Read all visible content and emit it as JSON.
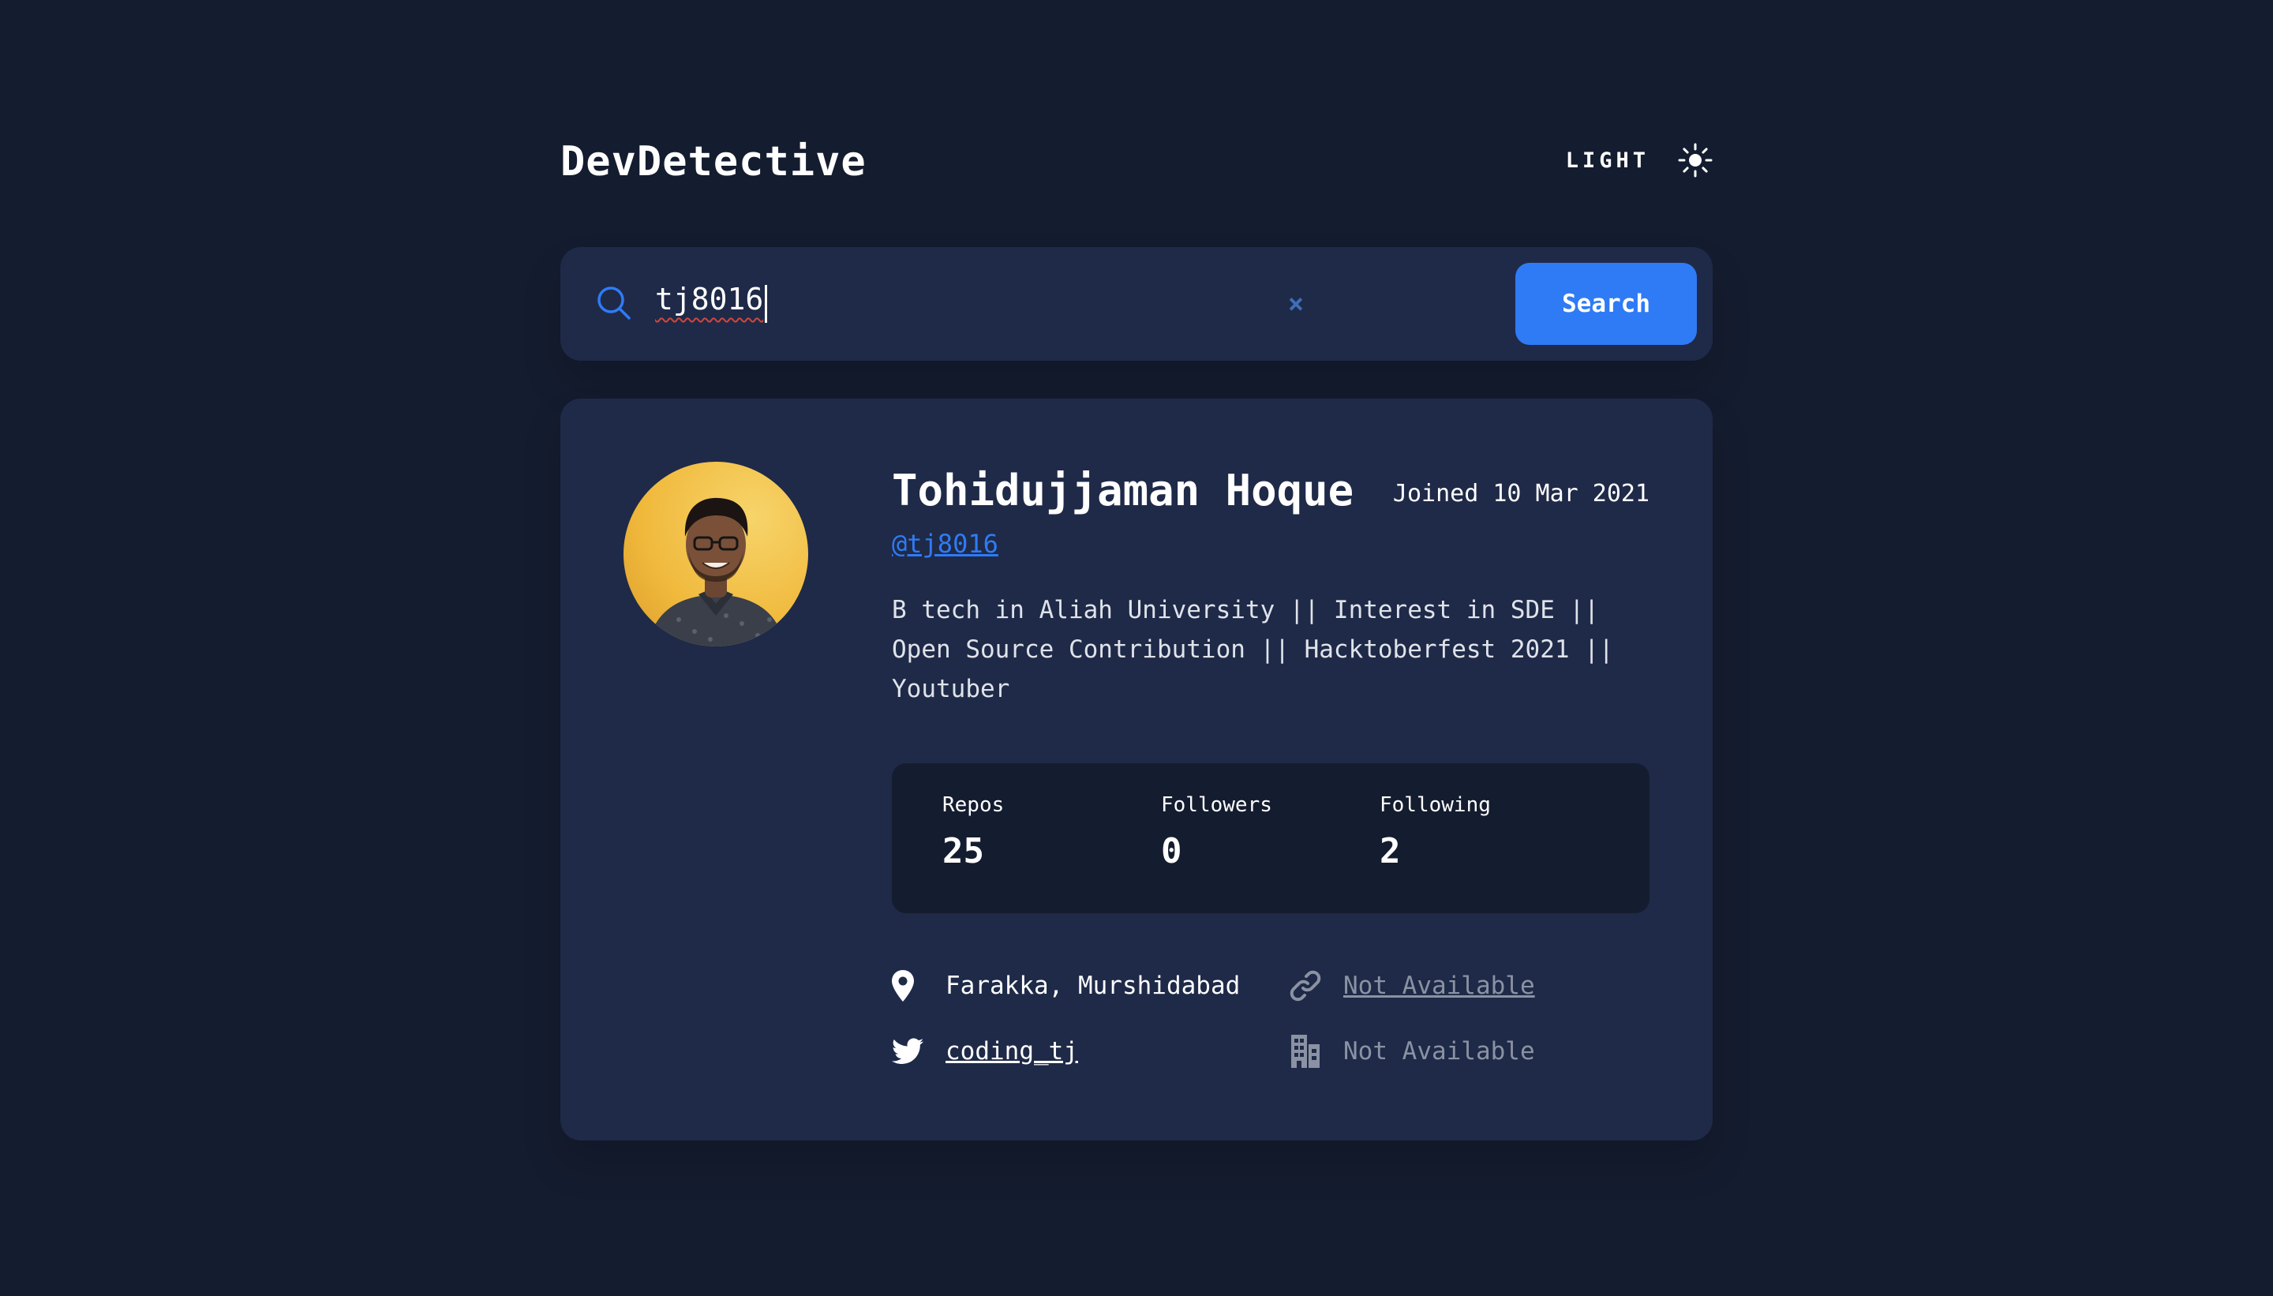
{
  "app": {
    "title": "DevDetective",
    "theme_toggle_label": "LIGHT",
    "theme_icon": "sun-icon"
  },
  "search": {
    "icon": "search-icon",
    "value": "tj8016",
    "clear_label": "×",
    "button_label": "Search"
  },
  "profile": {
    "name": "Tohidujjaman Hoque",
    "joined": "Joined 10 Mar 2021",
    "login": "@tj8016",
    "bio": "B tech in Aliah University || Interest in SDE ||\nOpen Source Contribution || Hacktoberfest 2021 ||\nYoutuber",
    "stats": {
      "repos_label": "Repos",
      "repos_value": "25",
      "followers_label": "Followers",
      "followers_value": "0",
      "following_label": "Following",
      "following_value": "2"
    },
    "links": {
      "location": "Farakka, Murshidabad",
      "website": "Not Available",
      "twitter": "coding_tj",
      "company": "Not Available"
    }
  },
  "colors": {
    "background": "#141c2f",
    "card": "#1f2a48",
    "accent": "#2f7bf5",
    "muted": "#8a92a3"
  }
}
